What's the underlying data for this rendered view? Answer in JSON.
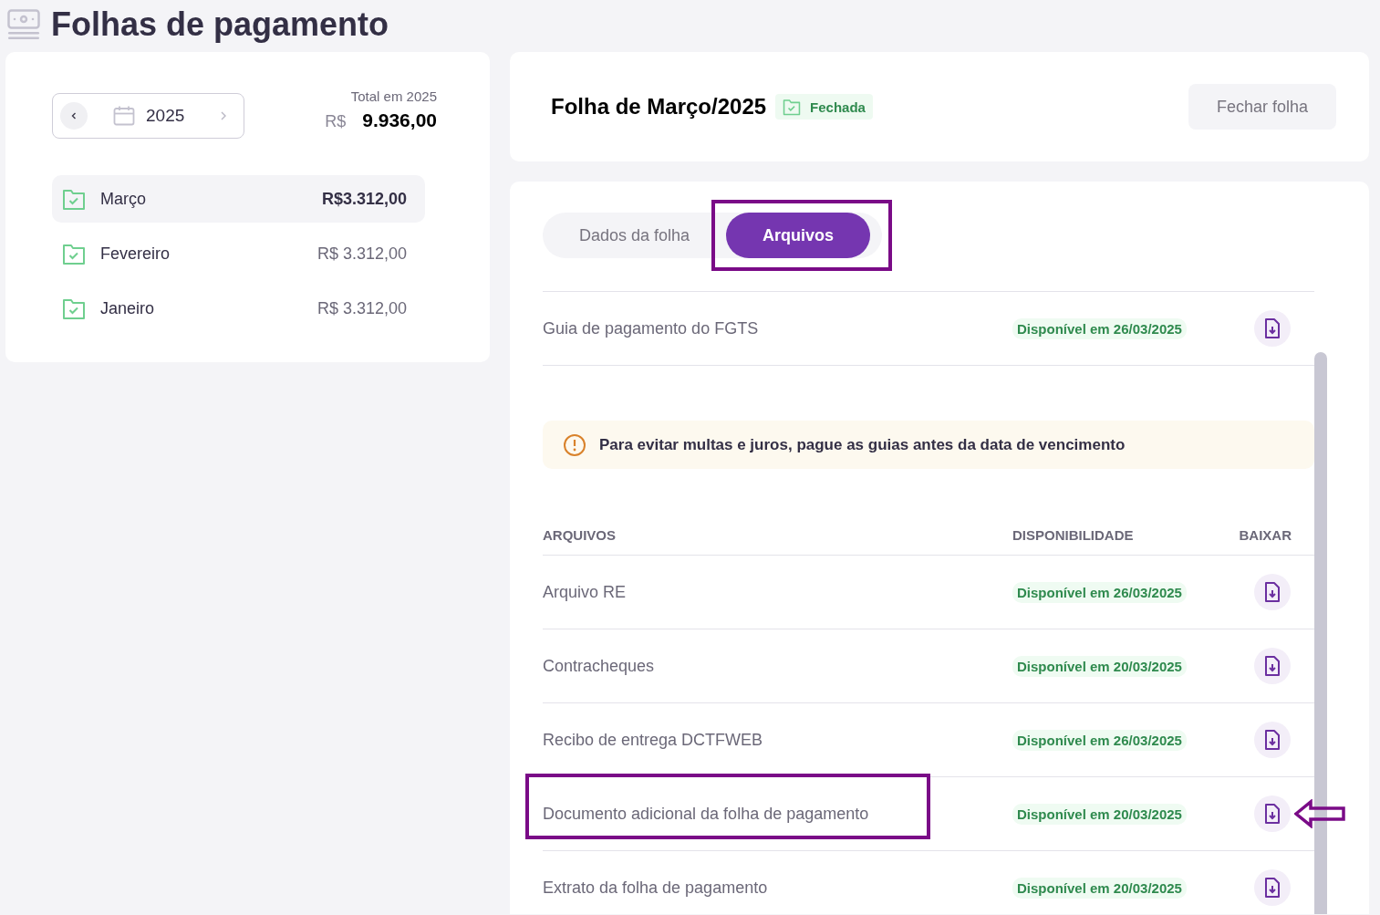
{
  "page": {
    "title": "Folhas de pagamento"
  },
  "year_picker": {
    "year": "2025"
  },
  "total": {
    "label": "Total em 2025",
    "currency": "R$",
    "amount": "9.936,00"
  },
  "months": [
    {
      "name": "Março",
      "amount": "R$3.312,00",
      "selected": true
    },
    {
      "name": "Fevereiro",
      "amount": "R$ 3.312,00",
      "selected": false
    },
    {
      "name": "Janeiro",
      "amount": "R$ 3.312,00",
      "selected": false
    }
  ],
  "sheet": {
    "title": "Folha de Março/2025",
    "status": "Fechada",
    "close_button": "Fechar folha"
  },
  "tabs": [
    {
      "label": "Dados da folha",
      "selected": false,
      "highlighted": false
    },
    {
      "label": "Arquivos",
      "selected": true,
      "highlighted": true
    }
  ],
  "top_rows": [
    {
      "name": "Guia de pagamento do FGTS",
      "availability": "Disponível em 26/03/2025"
    }
  ],
  "notice": "Para evitar multas e juros, pague as guias antes da data de vencimento",
  "table": {
    "columns": [
      "ARQUIVOS",
      "DISPONIBILIDADE",
      "BAIXAR"
    ],
    "rows": [
      {
        "name": "Arquivo RE",
        "availability": "Disponível em 26/03/2025",
        "highlighted": false,
        "pointed": false
      },
      {
        "name": "Contracheques",
        "availability": "Disponível em 20/03/2025",
        "highlighted": false,
        "pointed": false
      },
      {
        "name": "Recibo de entrega DCTFWEB",
        "availability": "Disponível em 26/03/2025",
        "highlighted": false,
        "pointed": false
      },
      {
        "name": "Documento adicional da folha de pagamento",
        "availability": "Disponível em 20/03/2025",
        "highlighted": true,
        "pointed": true
      },
      {
        "name": "Extrato da folha de pagamento",
        "availability": "Disponível em 20/03/2025",
        "highlighted": false,
        "pointed": false
      }
    ]
  }
}
